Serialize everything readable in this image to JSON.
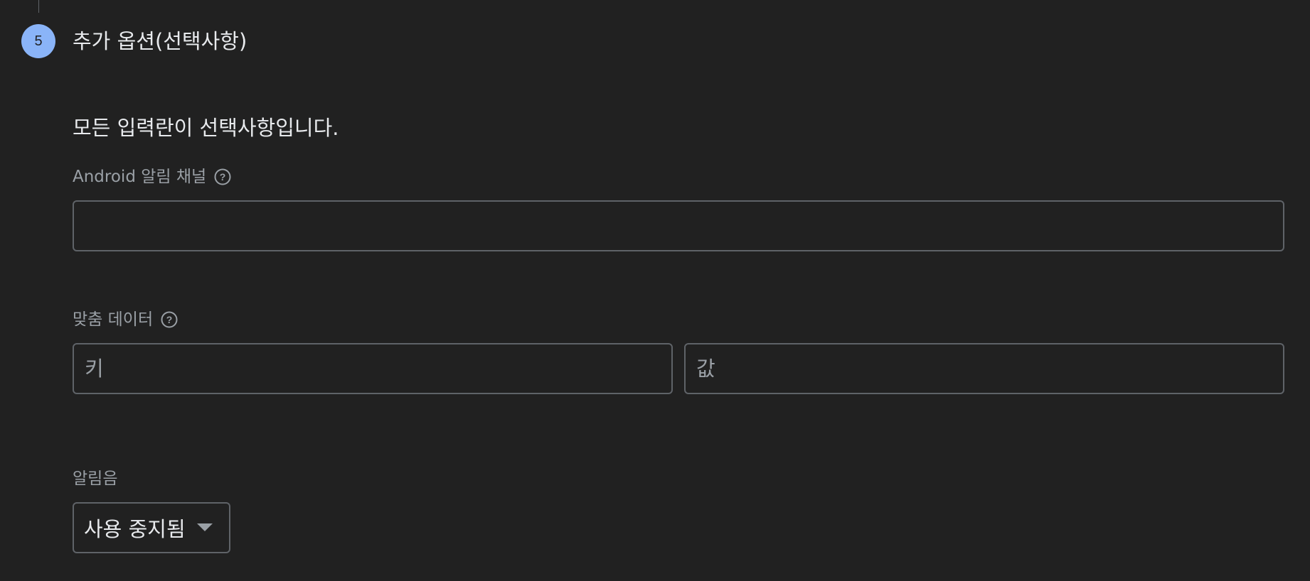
{
  "step": {
    "number": "5",
    "title": "추가 옵션(선택사항)"
  },
  "intro_text": "모든 입력란이 선택사항입니다.",
  "android_channel": {
    "label": "Android 알림 채널",
    "value": "",
    "help_icon": "help-circle-icon"
  },
  "custom_data": {
    "label": "맞춤 데이터",
    "help_icon": "help-circle-icon",
    "key_placeholder": "키",
    "value_placeholder": "값"
  },
  "sound": {
    "label": "알림음",
    "selected": "사용 중지됨",
    "arrow_icon": "dropdown-arrow-icon"
  },
  "colors": {
    "background": "#212121",
    "step_circle": "#8ab4f8",
    "border": "#5f6368",
    "label_text": "#9aa0a6",
    "primary_text": "#e8eaed"
  }
}
